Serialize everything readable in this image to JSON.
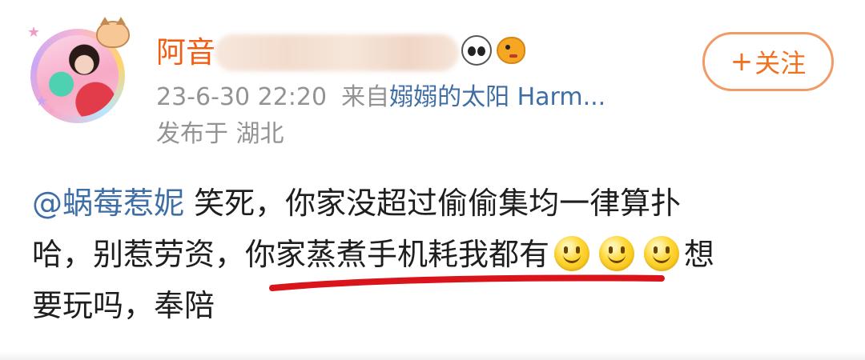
{
  "author": {
    "name": "阿音"
  },
  "follow_button": {
    "plus": "+",
    "label": "关注"
  },
  "meta": {
    "date": "23-6-30 22:20",
    "source_prefix": "来自",
    "source_name": "嫋嫋的太阳 Harm...",
    "location": "发布于 湖北"
  },
  "post": {
    "mention": "@蜗莓惹妮",
    "line1": " 笑死，你家没超过偷偷集均一律算扑",
    "line2_before": "哈，别惹劳资，",
    "line2_highlight": "你家蒸煮手机耗我都有",
    "line2_after": "想",
    "line3": "要玩吗，奉陪"
  },
  "icons": {
    "avatar": "user-avatar-icon",
    "badge_1": "panda-icon",
    "badge_2": "fish-icon",
    "emoji": "smile-emoji-icon"
  },
  "colors": {
    "author": "#f25d12",
    "link": "#3e6ea5",
    "meta": "#939393",
    "follow": "#f0711f",
    "underline": "#d9141b"
  }
}
